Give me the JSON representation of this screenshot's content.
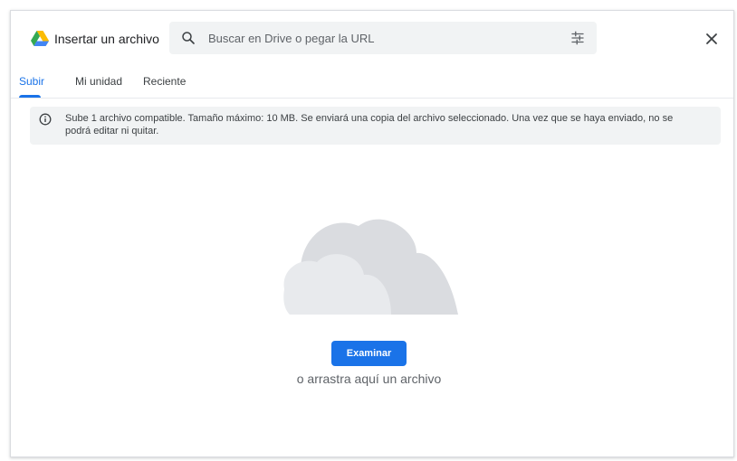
{
  "header": {
    "title": "Insertar un archivo",
    "logo_icon": "google-drive-icon",
    "search": {
      "placeholder": "Buscar en Drive o pegar la URL",
      "value": "",
      "search_icon": "search-icon",
      "options_icon": "tune-icon"
    },
    "close_icon": "close-icon"
  },
  "tabs": [
    {
      "label": "Subir",
      "active": true
    },
    {
      "label": "Mi unidad",
      "active": false
    },
    {
      "label": "Reciente",
      "active": false
    }
  ],
  "info": {
    "icon": "info-icon",
    "text": "Sube 1 archivo compatible. Tamaño máximo: 10 MB. Se enviará una copia del archivo seleccionado. Una vez que se haya enviado, no se podrá editar ni quitar."
  },
  "upload": {
    "illustration": "cloud-illustration",
    "browse_label": "Examinar",
    "drag_text": "o arrastra aquí un archivo"
  },
  "colors": {
    "accent": "#1a73e8",
    "panel": "#f1f3f4",
    "cloud_back": "#dadce0",
    "cloud_front": "#e8eaed"
  }
}
